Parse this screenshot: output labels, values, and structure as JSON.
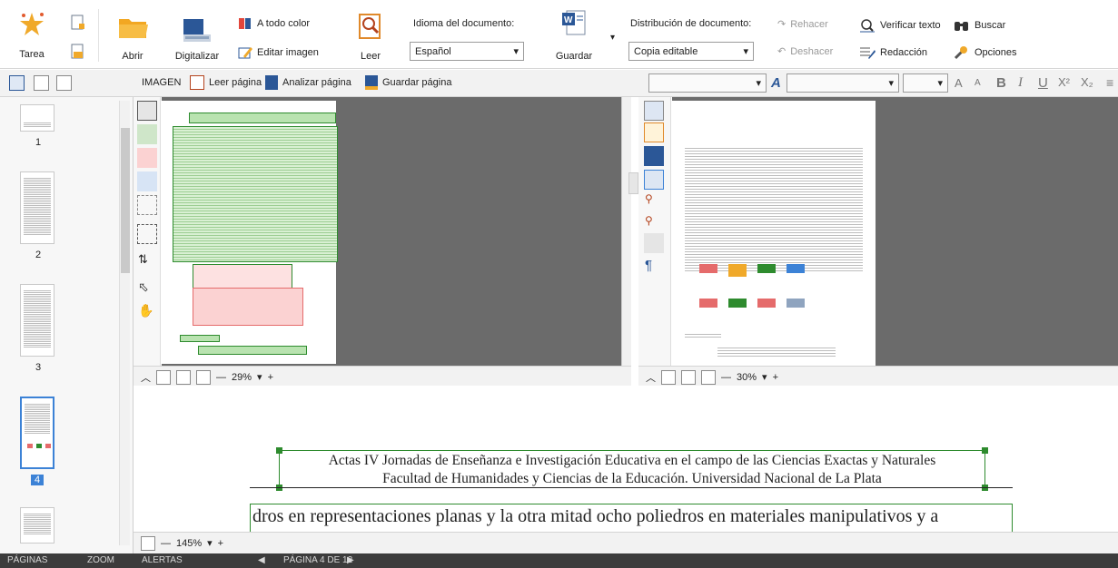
{
  "ribbon": {
    "tarea": "Tarea",
    "abrir": "Abrir",
    "digitalizar": "Digitalizar",
    "a_todo_color": "A todo color",
    "editar_imagen": "Editar imagen",
    "leer": "Leer",
    "idioma_label": "Idioma del documento:",
    "idioma_value": "Español",
    "guardar": "Guardar",
    "distribucion_label": "Distribución de documento:",
    "distribucion_value": "Copia editable",
    "rehacer": "Rehacer",
    "deshacer": "Deshacer",
    "verificar": "Verificar texto",
    "redaccion": "Redacción",
    "buscar": "Buscar",
    "opciones": "Opciones"
  },
  "subbar": {
    "imagen": "IMAGEN",
    "leer_pagina": "Leer página",
    "analizar_pagina": "Analizar página",
    "guardar_pagina": "Guardar página",
    "font_btns": [
      "A",
      "A",
      "B",
      "I",
      "U",
      "X²",
      "X₂"
    ]
  },
  "thumbs": [
    "1",
    "2",
    "3",
    "4"
  ],
  "image_zoom": "29%",
  "text_zoom": "30%",
  "doc_zoom": "145%",
  "doc": {
    "header1": "Actas IV Jornadas de Enseñanza e Investigación Educativa en el campo de las Ciencias Exactas y Naturales",
    "header2": "Facultad de Humanidades y Ciencias de la Educación. Universidad Nacional de La Plata",
    "body": "dros en representaciones planas y la otra mitad ocho poliedros en materiales manipulativos y a"
  },
  "status": {
    "paginas": "PÁGINAS",
    "zoom": "ZOOM",
    "alertas": "ALERTAS",
    "page_indicator": "PÁGINA 4 DE 12"
  },
  "colors": {
    "ribbon_blue": "#2b5797",
    "green_frame": "#2e8b2e",
    "text_green_bg": "#b9e3b0",
    "picture_red": "#e56b6b"
  }
}
